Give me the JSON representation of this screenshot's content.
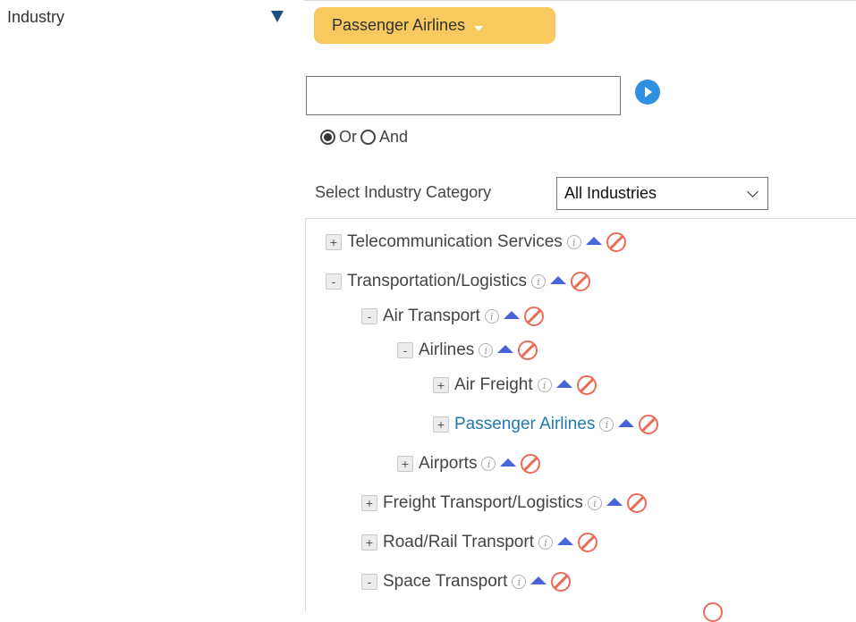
{
  "filter": {
    "label": "Industry",
    "selected_tag": "Passenger Airlines",
    "search": {
      "value": "",
      "placeholder": ""
    },
    "logic": {
      "options": [
        "Or",
        "And"
      ],
      "selected": "Or"
    },
    "category": {
      "label": "Select Industry Category",
      "selected": "All Industries"
    }
  },
  "tree": [
    {
      "label": "Telecommunication Services",
      "toggle": "+",
      "depth": 0,
      "selected": false
    },
    {
      "label": "Transportation/Logistics",
      "toggle": "-",
      "depth": 0,
      "selected": false
    },
    {
      "label": "Air Transport",
      "toggle": "-",
      "depth": 1,
      "selected": false
    },
    {
      "label": "Airlines",
      "toggle": "-",
      "depth": 2,
      "selected": false
    },
    {
      "label": "Air Freight",
      "toggle": "+",
      "depth": 3,
      "selected": false
    },
    {
      "label": "Passenger Airlines",
      "toggle": "+",
      "depth": 3,
      "selected": true
    },
    {
      "label": "Airports",
      "toggle": "+",
      "depth": 2,
      "selected": false
    },
    {
      "label": "Freight Transport/Logistics",
      "toggle": "+",
      "depth": 1,
      "selected": false
    },
    {
      "label": "Road/Rail Transport",
      "toggle": "+",
      "depth": 1,
      "selected": false
    },
    {
      "label": "Space Transport",
      "toggle": "-",
      "depth": 1,
      "selected": false
    }
  ],
  "icons": {
    "info": "info-icon",
    "move_up": "arrow-up-icon",
    "exclude": "exclude-icon",
    "go": "play-icon",
    "collapse": "triangle-down-icon"
  },
  "colors": {
    "tag_background": "#f8c95e",
    "selected_node": "#1f78b4",
    "up_arrow": "#4a63d9",
    "exclude": "#ec6b57",
    "go_button": "#2f8fe0",
    "collapse_arrow": "#1a4f80"
  }
}
